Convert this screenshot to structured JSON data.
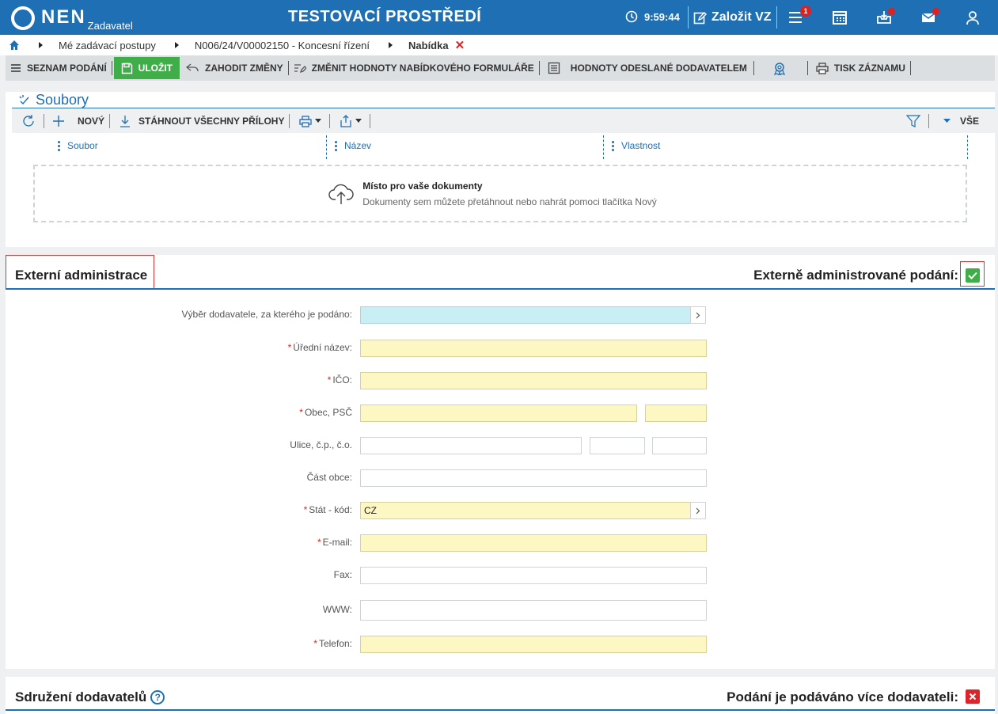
{
  "header": {
    "logo_text": "NEN",
    "logo_sub": "Zadavatel",
    "env_title": "TESTOVACÍ PROSTŘEDÍ",
    "time": "9:59:44",
    "create_label": "Založit VZ",
    "menu_badge": "1"
  },
  "breadcrumb": {
    "items": [
      "Mé zadávací postupy",
      "N006/24/V00002150 - Koncesní řízení",
      "Nabídka"
    ],
    "close": "✕"
  },
  "toolbar": {
    "list_label": "SEZNAM PODÁNÍ",
    "save_label": "ULOŽIT",
    "discard_label": "ZAHODIT ZMĚNY",
    "change_values_label": "ZMĚNIT HODNOTY NABÍDKOVÉHO FORMULÁŘE",
    "supplier_values_label": "HODNOTY ODESLANÉ DODAVATELEM",
    "print_label": "TISK ZÁZNAMU"
  },
  "files": {
    "title": "Soubory",
    "new_label": "NOVÝ",
    "download_all_label": "STÁHNOUT VŠECHNY PŘÍLOHY",
    "filter_all_label": "VŠE",
    "columns": [
      "Soubor",
      "Název",
      "Vlastnost"
    ],
    "dropzone_title": "Místo pro vaše dokumenty",
    "dropzone_sub": "Dokumenty sem můžete přetáhnout nebo nahrát pomoci tlačítka Nový"
  },
  "external": {
    "title": "Externí administrace",
    "toggle_label": "Externě administrované podání:",
    "toggle_checked": true,
    "fields": {
      "supplier_select": {
        "label": "Výběr dodavatele, za kterého je podáno:",
        "value": ""
      },
      "official_name": {
        "label": "Úřední název:",
        "value": ""
      },
      "ico": {
        "label": "IČO:",
        "value": ""
      },
      "city_zip": {
        "label": "Obec, PSČ",
        "city": "",
        "zip": ""
      },
      "street": {
        "label": "Ulice, č.p., č.o.",
        "street": "",
        "cp": "",
        "co": ""
      },
      "district": {
        "label": "Část obce:",
        "value": ""
      },
      "country": {
        "label": "Stát - kód:",
        "value": "CZ"
      },
      "email": {
        "label": "E-mail:",
        "value": ""
      },
      "fax": {
        "label": "Fax:",
        "value": ""
      },
      "www": {
        "label": "WWW:",
        "value": ""
      },
      "phone": {
        "label": "Telefon:",
        "value": ""
      }
    },
    "required_mark": "*"
  },
  "consortium": {
    "title": "Sdružení dodavatelů",
    "help": "?",
    "toggle_label": "Podání je podáváno více dodavateli:",
    "toggle_checked": false
  },
  "colors": {
    "brand_blue": "#1f6fb5",
    "save_green": "#3fae49",
    "required_yellow": "#fdf7c3",
    "select_cyan": "#c9eff5",
    "alert_red": "#e02020"
  }
}
